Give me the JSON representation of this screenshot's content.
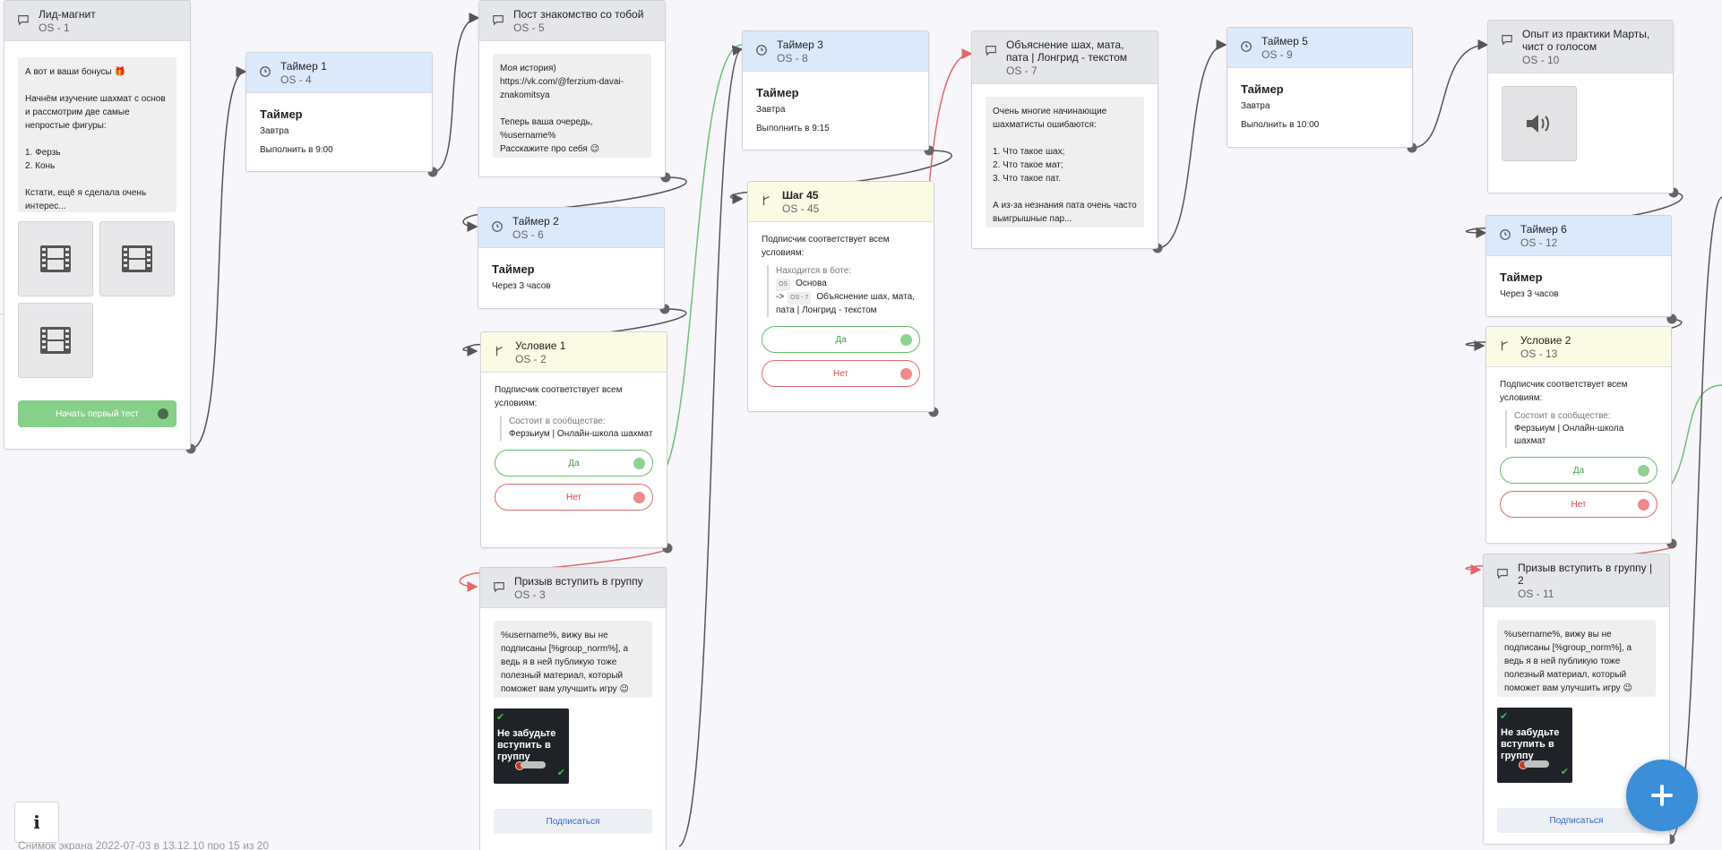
{
  "nodes": {
    "lead": {
      "title": "Лид-магнит",
      "sub": "OS - 1",
      "text": "А вот и ваши бонусы 🎁\n\nНачнём изучение шахмат с основ и рассмотрим две самые непростые фигуры:\n\n1. Ферзь\n2. Конь\n\nКстати, ещё я сделала очень интерес...",
      "media": [
        "video-icon",
        "video-icon",
        "video-icon"
      ],
      "button": "Начать первый тест"
    },
    "timer1": {
      "title": "Таймер 1",
      "sub": "OS - 4",
      "heading": "Таймер",
      "line1": "Завтра",
      "line2": "Выполнить в 9:00"
    },
    "post": {
      "title": "Пост знакомство со тобой",
      "sub": "OS - 5",
      "text": "Моя история)\nhttps://vk.com/@ferzium-davai-znakomitsya\n\nТеперь ваша очередь, %username%\nРасскажите про себя 😉"
    },
    "timer2": {
      "title": "Таймер 2",
      "sub": "OS - 6",
      "heading": "Таймер",
      "line1": "Через 3 часов"
    },
    "cond1": {
      "title": "Условие 1",
      "sub": "OS - 2",
      "text": "Подписчик соответствует всем условиям:",
      "label": "Состоит в сообществе:",
      "value": "Ферзьиум | Онлайн-школа шахмат",
      "yes": "Да",
      "no": "Нет"
    },
    "call": {
      "title": "Призыв вступить в группу",
      "sub": "OS - 3",
      "text": "%username%, вижу вы не подписаны [%group_norm%], а ведь я в ней публикую тоже полезный материал, который поможет вам улучшить игру 😉",
      "thumb": "Не забудьте вступить в группу",
      "button": "Подписаться"
    },
    "timer3": {
      "title": "Таймер 3",
      "sub": "OS - 8",
      "heading": "Таймер",
      "line1": "Завтра",
      "line2": "Выполнить в 9:15"
    },
    "step45": {
      "title": "Шаг 45",
      "sub": "OS - 45",
      "text": "Подписчик соответствует всем условиям:",
      "label": "Находится в боте:",
      "chip1": "OS",
      "val1": "Основа",
      "arrow": "->",
      "chip2": "OS - 7",
      "val2": "Объяснение шах, мата, пата | Лонгрид - текстом",
      "yes": "Да",
      "no": "Нет"
    },
    "explain": {
      "title": "Объяснение шах, мата, пата | Лонгрид - текстом",
      "sub": "OS - 7",
      "text": "Очень многие начинающие шахматисты ошибаются:\n\n1. Что такое шах;\n2. Что такое мат;\n3. Что такое пат.\n\nА из-за незнания пата очень часто выигрышные пар..."
    },
    "timer5": {
      "title": "Таймер 5",
      "sub": "OS - 9",
      "heading": "Таймер",
      "line1": "Завтра",
      "line2": "Выполнить в 10:00"
    },
    "opyt": {
      "title": "Опыт из практики Марты, чист о голосом",
      "sub": "OS - 10",
      "media": "audio-icon"
    },
    "timer6": {
      "title": "Таймер 6",
      "sub": "OS - 12",
      "heading": "Таймер",
      "line1": "Через 3 часов"
    },
    "cond2": {
      "title": "Условие 2",
      "sub": "OS - 13",
      "text": "Подписчик соответствует всем условиям:",
      "label": "Состоит в сообществе:",
      "value": "Ферзьиум | Онлайн-школа шахмат",
      "yes": "Да",
      "no": "Нет"
    },
    "call2": {
      "title": "Призыв вступить в группу | 2",
      "sub": "OS - 11",
      "text": "%username%, вижу вы не подписаны [%group_norm%], а ведь я в ней публикую тоже полезный материал, который поможет вам улучшить игру 😉",
      "thumb": "Не забудьте вступить в группу",
      "button": "Подписаться"
    }
  },
  "ui": {
    "info": "i",
    "fab_icon": "plus-icon",
    "status": "Снимок экрана 2022-07-03 в 13.12.10 про 15 из 20"
  },
  "colors": {
    "message_header": "#e4e6ea",
    "timer_header": "#dbe9fb",
    "condition_header": "#fbfbe5",
    "yes": "#5fbf63",
    "no": "#e06a6a",
    "accent": "#3a8fd8"
  }
}
